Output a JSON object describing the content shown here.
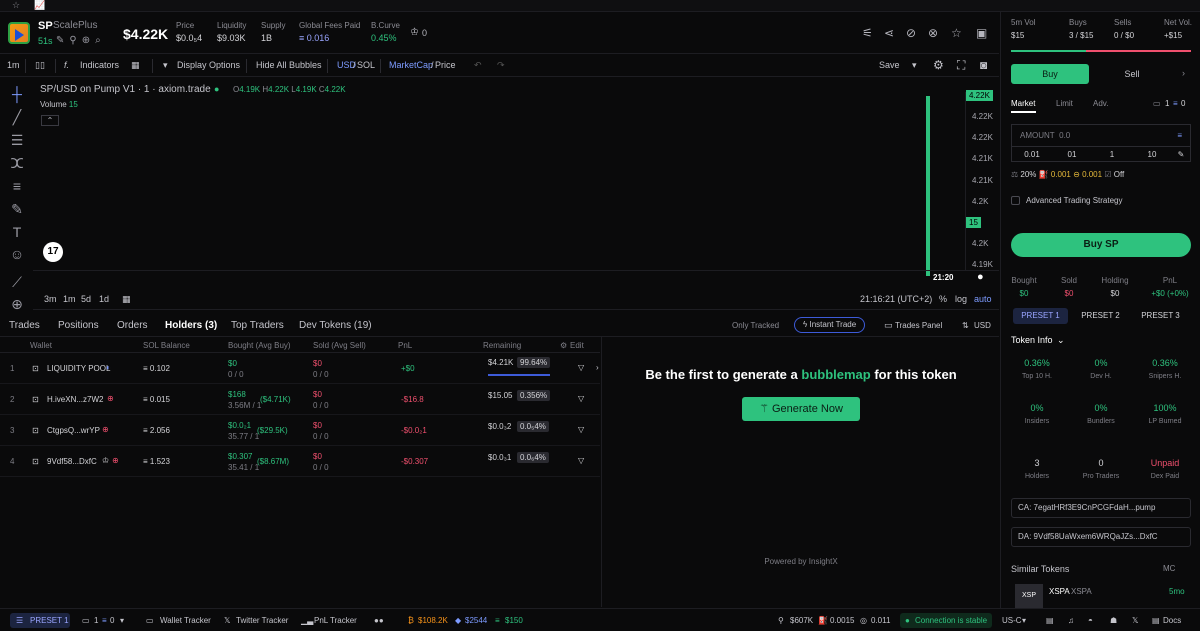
{
  "topbar": {
    "star": "☆",
    "chart": "📈"
  },
  "token": {
    "symbol": "SP",
    "name": "ScalePlus",
    "age": "51s",
    "price": "$4.22K",
    "stats": [
      {
        "label": "Price",
        "value": "$0.0₅4"
      },
      {
        "label": "Liquidity",
        "value": "$9.03K"
      },
      {
        "label": "Supply",
        "value": "1B"
      },
      {
        "label": "Global Fees Paid",
        "value": "≡ 0.016"
      },
      {
        "label": "B.Curve",
        "value": "0.45%"
      }
    ],
    "crown_count": "0"
  },
  "toolbar": {
    "interval": "1m",
    "indicators": "Indicators",
    "display_options": "Display Options",
    "hide_bubbles": "Hide All Bubbles",
    "pair_usd": "USD",
    "pair_sol": "SOL",
    "mc": "MarketCap",
    "price": "Price",
    "save": "Save"
  },
  "chart": {
    "title": "SP/USD on Pump V1 · 1 · axiom.trade",
    "ohlc": {
      "o": "4.19K",
      "h": "4.22K",
      "l": "4.19K",
      "c": "4.22K"
    },
    "volume_label": "Volume",
    "volume_value": "15",
    "y_ticks": [
      "4.22K",
      "4.22K",
      "4.22K",
      "4.21K",
      "4.21K",
      "4.2K",
      "15",
      "4.2K",
      "4.19K"
    ],
    "x_time": "21:20",
    "ranges": [
      "3m",
      "1m",
      "5d",
      "1d"
    ],
    "clock": "21:16:21 (UTC+2)",
    "pct": "%",
    "log": "log",
    "auto": "auto"
  },
  "tabs": {
    "items": [
      "Trades",
      "Positions",
      "Orders",
      "Holders (3)",
      "Top Traders",
      "Dev Tokens (19)"
    ],
    "only_tracked": "Only Tracked",
    "instant_trade": "Instant Trade",
    "trades_panel": "Trades Panel",
    "usd": "USD"
  },
  "table": {
    "headers": [
      "Wallet",
      "SOL Balance",
      "Bought (Avg Buy)",
      "Sold (Avg Sell)",
      "PnL",
      "Remaining",
      "Edit"
    ],
    "rows": [
      {
        "n": "1",
        "wallet": "LIQUIDITY POOL",
        "bal": "≡ 0.102",
        "bought": "$0",
        "bought_sub": "0 / 0",
        "bought_avg": "",
        "sold": "$0",
        "sold_sub": "0 / 0",
        "pnl": "+$0",
        "rem": "$4.21K",
        "rem_pct": "99.64%"
      },
      {
        "n": "2",
        "wallet": "H.iveXN...z7W2",
        "bal": "≡ 0.015",
        "bought": "$168",
        "bought_sub": "3.56M / 1",
        "bought_avg": "($4.71K)",
        "sold": "$0",
        "sold_sub": "0 / 0",
        "pnl": "-$16.8",
        "rem": "$15.05",
        "rem_pct": "0.356%"
      },
      {
        "n": "3",
        "wallet": "CtgpsQ...wrYP",
        "bal": "≡ 2.056",
        "bought": "$0.0₂1",
        "bought_sub": "35.77 / 1",
        "bought_avg": "($29.5K)",
        "sold": "$0",
        "sold_sub": "0 / 0",
        "pnl": "-$0.0₂1",
        "rem": "$0.0₃2",
        "rem_pct": "0.0₅4%"
      },
      {
        "n": "4",
        "wallet": "9Vdf58...DxfC",
        "bal": "≡ 1.523",
        "bought": "$0.307",
        "bought_sub": "35.41 / 1",
        "bought_avg": "($8.67M)",
        "sold": "$0",
        "sold_sub": "0 / 0",
        "pnl": "-$0.307",
        "rem": "$0.0₃1",
        "rem_pct": "0.0₆4%"
      }
    ]
  },
  "bubble": {
    "title_pre": "Be the first to generate a",
    "title_acc": "bubblemap",
    "title_post": "for this token",
    "button": "Generate Now",
    "powered": "Powered by InsightX"
  },
  "right": {
    "stats": [
      {
        "label": "5m Vol",
        "value": "$15"
      },
      {
        "label": "Buys",
        "value": "3 / $15"
      },
      {
        "label": "Sells",
        "value": "0 / $0"
      },
      {
        "label": "Net Vol.",
        "value": "+$15"
      }
    ],
    "buy": "Buy",
    "sell": "Sell",
    "mode_tabs": [
      "Market",
      "Limit",
      "Adv."
    ],
    "wallet_count": "1",
    "wallet_bal": "0",
    "amount_label": "AMOUNT",
    "amount_placeholder": "0.0",
    "amounts": [
      "0.01",
      "01",
      "1",
      "10"
    ],
    "slip": "20%",
    "prio": "0.001",
    "bribe": "0.001",
    "off": "Off",
    "adv_strategy": "Advanced Trading Strategy",
    "buy_btn": "Buy SP",
    "bh": [
      {
        "label": "Bought",
        "value": "$0"
      },
      {
        "label": "Sold",
        "value": "$0"
      },
      {
        "label": "Holding",
        "value": "$0"
      },
      {
        "label": "PnL",
        "value": "+$0 (+0%)"
      }
    ],
    "presets": [
      "PRESET 1",
      "PRESET 2",
      "PRESET 3"
    ],
    "token_info": "Token Info",
    "info": [
      {
        "v": "0.36%",
        "l": "Top 10 H.",
        "c": "#2ec27e"
      },
      {
        "v": "0%",
        "l": "Dev H.",
        "c": "#2ec27e"
      },
      {
        "v": "0.36%",
        "l": "Snipers H.",
        "c": "#2ec27e"
      },
      {
        "v": "0%",
        "l": "Insiders",
        "c": "#2ec27e"
      },
      {
        "v": "0%",
        "l": "Bundlers",
        "c": "#2ec27e"
      },
      {
        "v": "100%",
        "l": "LP Burned",
        "c": "#2ec27e"
      },
      {
        "v": "3",
        "l": "Holders",
        "c": "#d4d4d8"
      },
      {
        "v": "0",
        "l": "Pro Traders",
        "c": "#d4d4d8"
      },
      {
        "v": "Unpaid",
        "l": "Dex Paid",
        "c": "#f0506e"
      }
    ],
    "ca": "CA: 7egatHRf3E9CnPCGFdaH...pump",
    "da": "DA: 9Vdf58UaWxem6WRQaJZs...DxfC",
    "similar": "Similar Tokens",
    "mc": "MC",
    "sim_sym": "XSPA",
    "sim_name": "XSPA",
    "sim_age": "5mo",
    "sim_logo": "XSP"
  },
  "footer": {
    "preset": "PRESET 1",
    "wallet": "1",
    "wallet_bal": "0",
    "wallet_tracker": "Wallet Tracker",
    "twitter_tracker": "Twitter Tracker",
    "pnl_tracker": "PnL Tracker",
    "btc": "$108.2K",
    "eth": "$2544",
    "sol": "$150",
    "mc": "$607K",
    "fee": "0.0015",
    "gas": "0.011",
    "conn": "Connection is stable",
    "region": "US-C",
    "docs": "Docs"
  }
}
